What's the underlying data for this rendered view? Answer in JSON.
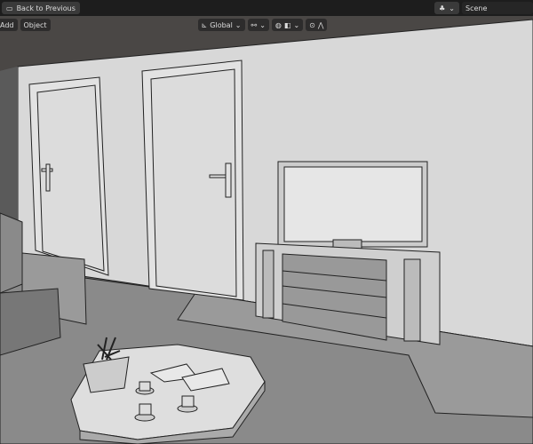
{
  "topbar": {
    "back_label": "Back to Previous",
    "scene_value": "Scene"
  },
  "header": {
    "menus": [
      "Add",
      "Object"
    ],
    "orientation": "Global"
  },
  "icons": [
    "monitor-icon",
    "scene-icon",
    "orientation-icon",
    "pivot-icon",
    "snap-icon",
    "proportional-icon"
  ]
}
